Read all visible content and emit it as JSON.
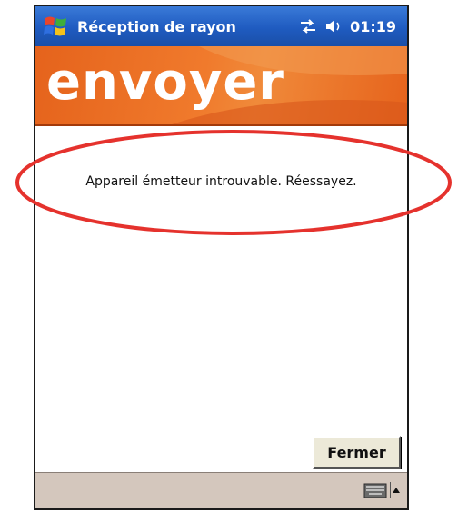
{
  "titlebar": {
    "app_title": "Réception de rayon",
    "clock": "01:19",
    "start_icon": "windows-flag-icon",
    "connectivity_icon": "connectivity-icon",
    "volume_icon": "speaker-icon"
  },
  "banner": {
    "title": "envoyer"
  },
  "content": {
    "message": "Appareil émetteur introuvable. Réessayez.",
    "close_label": "Fermer"
  },
  "menubar": {
    "keyboard_icon": "keyboard-icon",
    "arrow_icon": "up-arrow-icon"
  },
  "colors": {
    "titlebar_blue": "#1f5bc0",
    "banner_orange": "#f07a2c",
    "highlight_red": "#e5322d",
    "menubar_bg": "#d4c7bd"
  }
}
